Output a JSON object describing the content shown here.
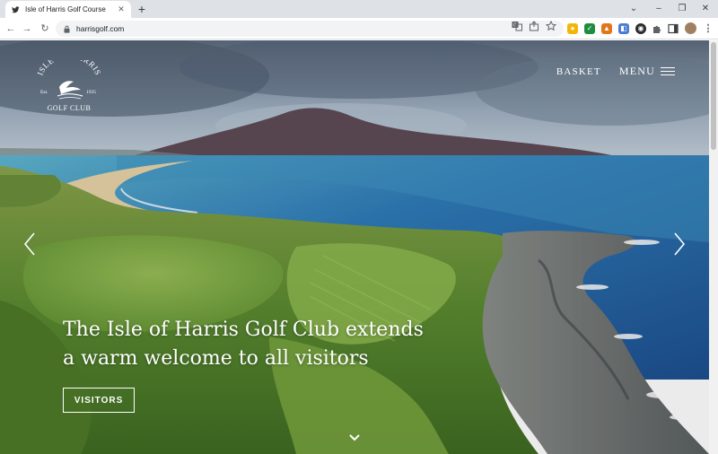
{
  "browser": {
    "tab_title": "Isle of Harris Golf Course",
    "url": "harrisgolf.com"
  },
  "site": {
    "logo_top": "ISLE OF HARRIS",
    "logo_est_left": "Est.",
    "logo_est_right": "1935",
    "logo_bottom": "GOLF CLUB",
    "basket_label": "BASKET",
    "menu_label": "MENU"
  },
  "hero": {
    "headline": "The Isle of Harris Golf Club extends a warm welcome to all visitors",
    "cta_label": "VISITORS"
  },
  "icons": [
    "twitter-bird-icon",
    "close-icon",
    "plus-icon",
    "back-arrow-icon",
    "forward-arrow-icon",
    "reload-icon",
    "lock-icon",
    "translate-icon",
    "share-icon",
    "star-icon",
    "puzzle-icon",
    "sidepanel-icon",
    "profile-avatar",
    "kebab-menu-icon",
    "hamburger-icon",
    "chevron-left-icon",
    "chevron-right-icon",
    "chevron-down-icon"
  ],
  "colors": {
    "sea": "#2f7bb8",
    "grass": "#5a8a30",
    "sand": "#e8d3a8",
    "chrome": "#dee1e6"
  }
}
